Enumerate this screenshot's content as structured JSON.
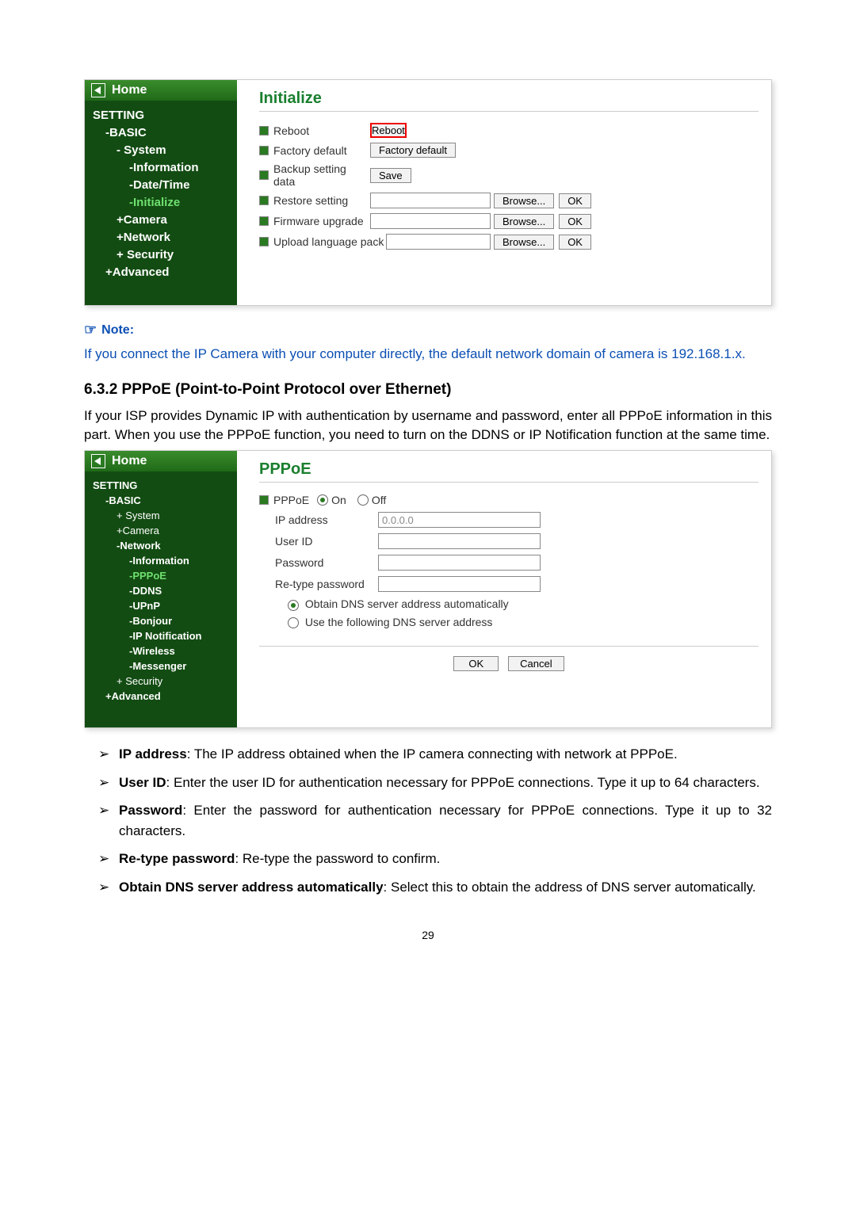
{
  "screenshot1": {
    "home": "Home",
    "tree": {
      "setting": "SETTING",
      "basic": "BASIC",
      "system": "System",
      "information": "Information",
      "datetime": "Date/Time",
      "initialize": "Initialize",
      "camera": "Camera",
      "network": "Network",
      "security": "Security",
      "advanced": "Advanced"
    },
    "title": "Initialize",
    "labels": {
      "reboot": "Reboot",
      "factory": "Factory default",
      "backup": "Backup setting data",
      "restore": "Restore setting",
      "firmware": "Firmware upgrade",
      "upload": "Upload language pack"
    },
    "buttons": {
      "reboot": "Reboot",
      "factory": "Factory default",
      "save": "Save",
      "browse": "Browse...",
      "ok": "OK"
    }
  },
  "note_label": "Note:",
  "note_text": "If you connect the IP Camera with your computer directly, the default network domain of camera is 192.168.1.x.",
  "section_heading": "6.3.2  PPPoE (Point-to-Point Protocol over Ethernet)",
  "section_intro": "If your ISP provides Dynamic IP with authentication by username and password, enter all PPPoE information in this part. When you use the PPPoE function, you need to turn on the DDNS or IP Notification function at the same time.",
  "screenshot2": {
    "home": "Home",
    "tree": {
      "setting": "SETTING",
      "basic": "BASIC",
      "system": "System",
      "camera": "Camera",
      "network": "Network",
      "information": "Information",
      "pppoe": "PPPoE",
      "ddns": "DDNS",
      "upnp": "UPnP",
      "bonjour": "Bonjour",
      "ipnotif": "IP Notification",
      "wireless": "Wireless",
      "messenger": "Messenger",
      "security": "Security",
      "advanced": "Advanced"
    },
    "title": "PPPoE",
    "labels": {
      "pppoe": "PPPoE",
      "on": "On",
      "off": "Off",
      "ip": "IP address",
      "ip_value": "0.0.0.0",
      "userid": "User ID",
      "password": "Password",
      "retype": "Re-type password",
      "dns_auto": "Obtain DNS server address automatically",
      "dns_manual": "Use the following DNS server address"
    },
    "buttons": {
      "ok": "OK",
      "cancel": "Cancel"
    }
  },
  "bullets": {
    "b1_label": "IP address",
    "b1_text": ": The IP address obtained when the IP camera connecting with network at PPPoE.",
    "b2_label": "User ID",
    "b2_text": ": Enter the user ID for authentication necessary for PPPoE connections. Type it up to 64 characters.",
    "b3_label": "Password",
    "b3_text": ": Enter the password for authentication necessary for PPPoE connections. Type it up to 32 characters.",
    "b4_label": "Re-type password",
    "b4_text": ": Re-type the password to confirm.",
    "b5_label": "Obtain DNS server address automatically",
    "b5_text": ": Select this to obtain the address of DNS server automatically."
  },
  "page_number": "29"
}
